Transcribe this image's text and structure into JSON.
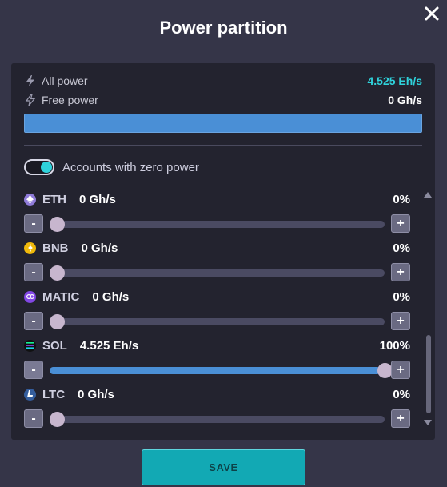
{
  "dialog": {
    "title": "Power partition",
    "close_icon": "close-icon"
  },
  "summary": {
    "all_power_label": "All power",
    "all_power_value": "4.525 Eh/s",
    "all_power_color": "#2fd3dc",
    "free_power_label": "Free power",
    "free_power_value": "0 Gh/s",
    "allocated_fraction": 1.0
  },
  "toggle": {
    "label": "Accounts with zero power",
    "on": true
  },
  "coins": [
    {
      "name": "ETH",
      "value": "0 Gh/s",
      "percent": "0%",
      "fraction": 0,
      "icon": "eth-icon",
      "color": "#8f7bd9"
    },
    {
      "name": "BNB",
      "value": "0 Gh/s",
      "percent": "0%",
      "fraction": 0,
      "icon": "bnb-icon",
      "color": "#f0b90b"
    },
    {
      "name": "MATIC",
      "value": "0 Gh/s",
      "percent": "0%",
      "fraction": 0,
      "icon": "matic-icon",
      "color": "#8247e5"
    },
    {
      "name": "SOL",
      "value": "4.525 Eh/s",
      "percent": "100%",
      "fraction": 1,
      "icon": "sol-icon",
      "color": "#111111"
    },
    {
      "name": "LTC",
      "value": "0 Gh/s",
      "percent": "0%",
      "fraction": 0,
      "icon": "ltc-icon",
      "color": "#345d9d"
    }
  ],
  "stepper": {
    "minus": "-",
    "plus": "+"
  },
  "save_label": "SAVE",
  "colors": {
    "accent": "#12a9b4",
    "slider_fill": "#4a8fd6"
  }
}
